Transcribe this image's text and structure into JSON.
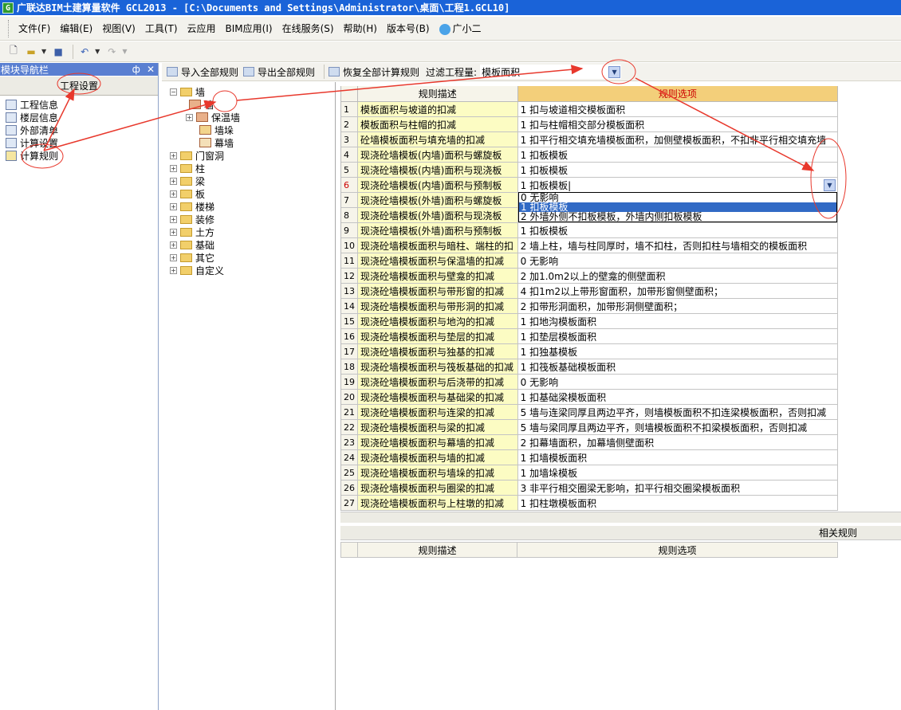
{
  "window": {
    "title": "广联达BIM土建算量软件 GCL2013 - [C:\\Documents and Settings\\Administrator\\桌面\\工程1.GCL10]",
    "app_icon_label": "G"
  },
  "menu": {
    "items": [
      "文件(F)",
      "编辑(E)",
      "视图(V)",
      "工具(T)",
      "云应用",
      "BIM应用(I)",
      "在线服务(S)",
      "帮助(H)",
      "版本号(B)",
      "广小二"
    ]
  },
  "nav": {
    "header": "模块导航栏",
    "pin": "ф",
    "close": "✕",
    "tab": "工程设置",
    "items": [
      "工程信息",
      "楼层信息",
      "外部清单",
      "计算设置",
      "计算规则"
    ]
  },
  "rule_toolbar": {
    "import_label": "导入全部规则",
    "export_label": "导出全部规则",
    "restore_label": "恢复全部计算规则",
    "filter_label": "过滤工程量:",
    "filter_value": "模板面积"
  },
  "tree": {
    "root": "墙",
    "children": [
      "墙",
      "保温墙",
      "墙垛",
      "幕墙"
    ],
    "others": [
      "门窗洞",
      "柱",
      "梁",
      "板",
      "楼梯",
      "装修",
      "土方",
      "基础",
      "其它",
      "自定义"
    ]
  },
  "grid": {
    "header_desc": "规则描述",
    "header_opt": "规则选项",
    "rows": [
      {
        "n": "1",
        "desc": "模板面积与坡道的扣减",
        "opt": "1 扣与坡道相交模板面积"
      },
      {
        "n": "2",
        "desc": "模板面积与柱帽的扣减",
        "opt": "1 扣与柱帽相交部分模板面积"
      },
      {
        "n": "3",
        "desc": "砼墙模板面积与填充墙的扣减",
        "opt": "1 扣平行相交填充墙模板面积，加侧壁模板面积，不扣非平行相交填充墙"
      },
      {
        "n": "4",
        "desc": "现浇砼墙模板(内墙)面积与螺旋板",
        "opt": "1  扣板模板"
      },
      {
        "n": "5",
        "desc": "现浇砼墙模板(内墙)面积与现浇板",
        "opt": "1  扣板模板"
      },
      {
        "n": "6",
        "desc": "现浇砼墙模板(内墙)面积与预制板",
        "opt": "1  扣板模板|"
      },
      {
        "n": "7",
        "desc": "现浇砼墙模板(外墙)面积与螺旋板",
        "opt": ""
      },
      {
        "n": "8",
        "desc": "现浇砼墙模板(外墙)面积与现浇板",
        "opt": ""
      },
      {
        "n": "9",
        "desc": "现浇砼墙模板(外墙)面积与预制板",
        "opt": "1  扣板模板"
      },
      {
        "n": "10",
        "desc": "现浇砼墙模板面积与暗柱、端柱的扣",
        "opt": "2  墙上柱，墙与柱同厚时，墙不扣柱，否则扣柱与墙相交的模板面积"
      },
      {
        "n": "11",
        "desc": "现浇砼墙模板面积与保温墙的扣减",
        "opt": "0  无影响"
      },
      {
        "n": "12",
        "desc": "现浇砼墙模板面积与壁龛的扣减",
        "opt": "2  加1.0m2以上的壁龛的侧壁面积"
      },
      {
        "n": "13",
        "desc": "现浇砼墙模板面积与带形窗的扣减",
        "opt": "4  扣1m2以上带形窗面积，加带形窗侧壁面积；"
      },
      {
        "n": "14",
        "desc": "现浇砼墙模板面积与带形洞的扣减",
        "opt": "2  扣带形洞面积，加带形洞侧壁面积；"
      },
      {
        "n": "15",
        "desc": "现浇砼墙模板面积与地沟的扣减",
        "opt": "1  扣地沟模板面积"
      },
      {
        "n": "16",
        "desc": "现浇砼墙模板面积与垫层的扣减",
        "opt": "1  扣垫层模板面积"
      },
      {
        "n": "17",
        "desc": "现浇砼墙模板面积与独基的扣减",
        "opt": "1  扣独基模板"
      },
      {
        "n": "18",
        "desc": "现浇砼墙模板面积与筏板基础的扣减",
        "opt": "1  扣筏板基础模板面积"
      },
      {
        "n": "19",
        "desc": "现浇砼墙模板面积与后浇带的扣减",
        "opt": "0  无影响"
      },
      {
        "n": "20",
        "desc": "现浇砼墙模板面积与基础梁的扣减",
        "opt": "1  扣基础梁模板面积"
      },
      {
        "n": "21",
        "desc": "现浇砼墙模板面积与连梁的扣减",
        "opt": "5 墙与连梁同厚且两边平齐，则墙模板面积不扣连梁模板面积，否则扣减"
      },
      {
        "n": "22",
        "desc": "现浇砼墙模板面积与梁的扣减",
        "opt": "5  墙与梁同厚且两边平齐，则墙模板面积不扣梁模板面积，否则扣减"
      },
      {
        "n": "23",
        "desc": "现浇砼墙模板面积与幕墙的扣减",
        "opt": "2 扣幕墙面积，加幕墙侧壁面积"
      },
      {
        "n": "24",
        "desc": "现浇砼墙模板面积与墙的扣减",
        "opt": "1  扣墙模板面积"
      },
      {
        "n": "25",
        "desc": "现浇砼墙模板面积与墙垛的扣减",
        "opt": "1  加墙垛模板"
      },
      {
        "n": "26",
        "desc": "现浇砼墙模板面积与圈梁的扣减",
        "opt": "3  非平行相交圈梁无影响，扣平行相交圈梁模板面积"
      },
      {
        "n": "27",
        "desc": "现浇砼墙模板面积与上柱墩的扣减",
        "opt": "1  扣柱墩模板面积"
      }
    ]
  },
  "dropdown": {
    "options": [
      "0  无影响",
      "1  扣板模板",
      "2  外墙外侧不扣板模板，外墙内侧扣板模板"
    ],
    "selected_index": 1
  },
  "related": {
    "title": "相关规则",
    "header_desc": "规则描述",
    "header_opt": "规则选项"
  },
  "annotation_color": "#e8382c"
}
